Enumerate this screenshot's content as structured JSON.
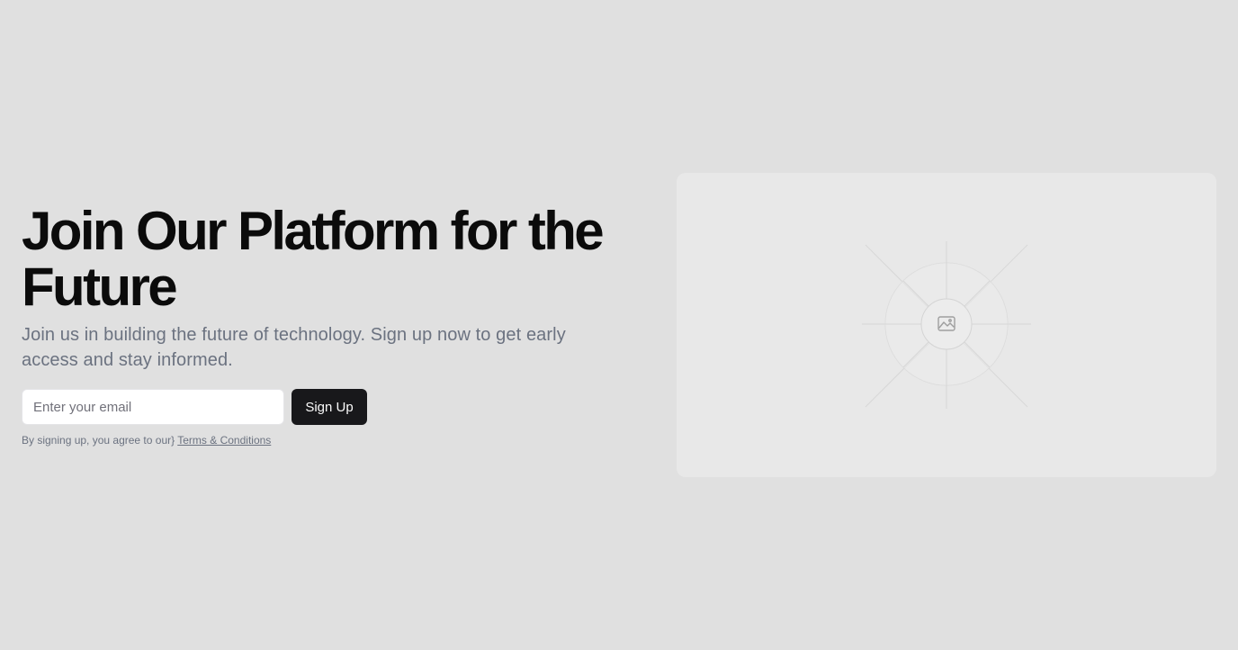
{
  "hero": {
    "headline": "Join Our Platform for the Future",
    "subtitle": "Join us in building the future of technology. Sign up now to get early access and stay informed."
  },
  "signup": {
    "email_placeholder": "Enter your email",
    "button_label": "Sign Up",
    "terms_prefix": "By signing up, you agree to our}",
    "terms_link": "Terms & Conditions"
  },
  "media": {
    "icon": "image-icon"
  },
  "colors": {
    "background": "#e0e0e0",
    "card": "#e8e8e8",
    "button": "#18181b",
    "muted_text": "#6b7280"
  }
}
